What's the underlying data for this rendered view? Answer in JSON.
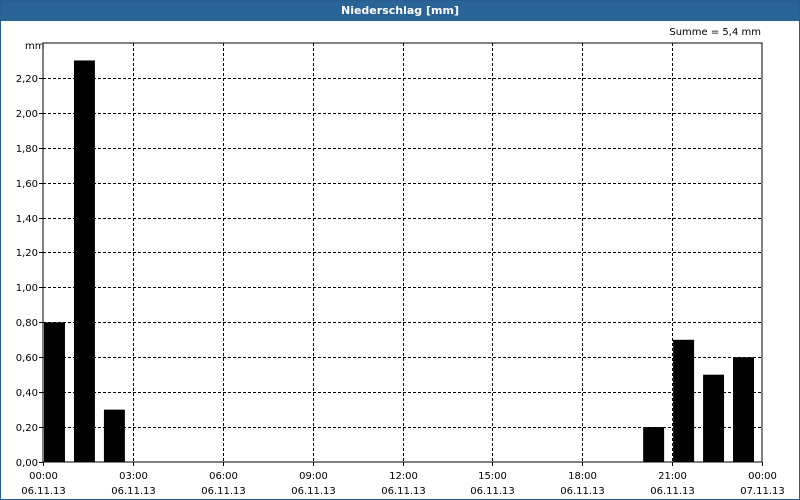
{
  "window": {
    "title": "Niederschlag [mm]"
  },
  "summary": {
    "text": "Summe = 5,4 mm"
  },
  "chart_data": {
    "type": "bar",
    "title": "Niederschlag [mm]",
    "ylabel": "mm",
    "ylim": [
      0,
      2.4
    ],
    "yticks": [
      "0,00",
      "0,20",
      "0,40",
      "0,60",
      "0,80",
      "1,00",
      "1,20",
      "1,40",
      "1,60",
      "1,80",
      "2,00",
      "2,20"
    ],
    "xticks": [
      {
        "time": "00:00",
        "date": "06.11.13"
      },
      {
        "time": "03:00",
        "date": "06.11.13"
      },
      {
        "time": "06:00",
        "date": "06.11.13"
      },
      {
        "time": "09:00",
        "date": "06.11.13"
      },
      {
        "time": "12:00",
        "date": "06.11.13"
      },
      {
        "time": "15:00",
        "date": "06.11.13"
      },
      {
        "time": "18:00",
        "date": "06.11.13"
      },
      {
        "time": "21:00",
        "date": "06.11.13"
      },
      {
        "time": "00:00",
        "date": "07.11.13"
      }
    ],
    "bar_color": "#000000",
    "grid": true,
    "series": [
      {
        "bars": [
          {
            "hour": 0.0,
            "value": 0.8
          },
          {
            "hour": 1.0,
            "value": 2.3
          },
          {
            "hour": 2.0,
            "value": 0.3
          },
          {
            "hour": 20.0,
            "value": 0.2
          },
          {
            "hour": 21.0,
            "value": 0.7
          },
          {
            "hour": 22.0,
            "value": 0.5
          },
          {
            "hour": 23.0,
            "value": 0.6
          }
        ]
      }
    ]
  }
}
